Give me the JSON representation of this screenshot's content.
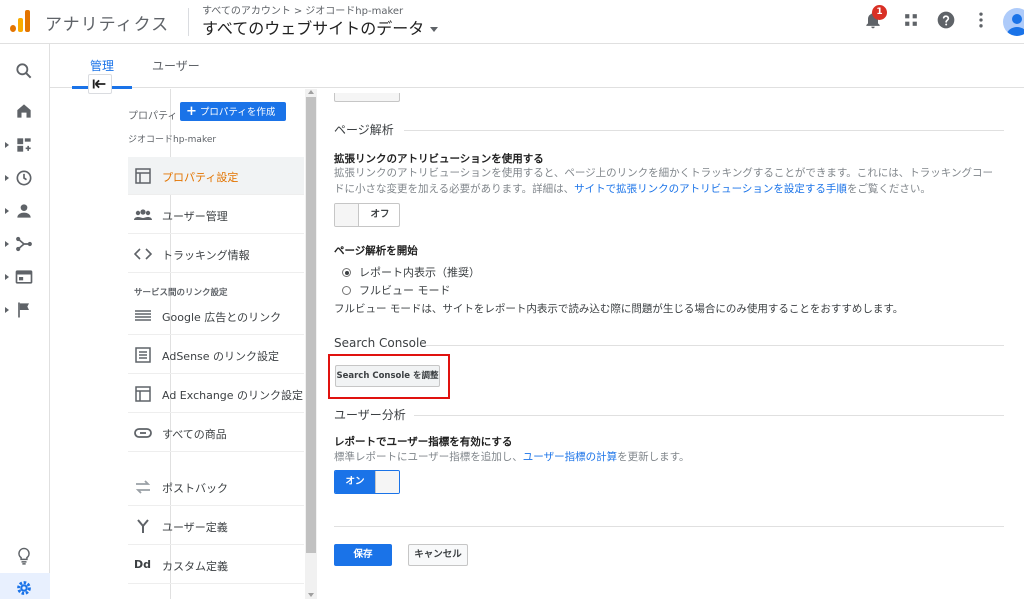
{
  "header": {
    "app_name": "アナリティクス",
    "breadcrumb": [
      "すべてのアカウント",
      "ジオコードhp-maker"
    ],
    "breadcrumb_sep": ">",
    "view_name": "すべてのウェブサイトのデータ",
    "notification_count": "1"
  },
  "tabs": [
    {
      "label": "管理"
    },
    {
      "label": "ユーザー"
    }
  ],
  "property_panel": {
    "label": "プロパティ",
    "create_button": "プロパティを作成",
    "create_plus": "+",
    "property_name": "ジオコードhp-maker",
    "items": [
      {
        "label": "プロパティ設定"
      },
      {
        "label": "ユーザー管理"
      },
      {
        "label": "トラッキング情報"
      },
      {
        "label": "Google 広告とのリンク"
      },
      {
        "label": "AdSense のリンク設定"
      },
      {
        "label": "Ad Exchange のリンク設定"
      },
      {
        "label": "すべての商品"
      },
      {
        "label": "ポストバック"
      },
      {
        "label": "ユーザー定義"
      },
      {
        "label": "カスタム定義"
      }
    ],
    "section_header": "サービス間のリンク設定",
    "custom_def_icon_text": "Dd"
  },
  "settings": {
    "page_analysis": {
      "title": "ページ解析",
      "enhanced_link": {
        "title": "拡張リンクのアトリビューションを使用する",
        "desc_prefix": "拡張リンクのアトリビューションを使用すると、ページ上のリンクを細かくトラッキングすることができます。これには、トラッキングコードに小さな変更を加える必要があります。詳細は、",
        "desc_link": "サイトで拡張リンクのアトリビューションを設定する手順",
        "desc_suffix": "をご覧ください。",
        "toggle": "オフ"
      },
      "start": {
        "title": "ページ解析を開始",
        "option_inline": "レポート内表示（推奨）",
        "option_full": "フルビュー モード",
        "note": "フルビュー モードは、サイトをレポート内表示で読み込む際に問題が生じる場合にのみ使用することをおすすめします。"
      }
    },
    "search_console": {
      "title": "Search Console",
      "button": "Search Console を調整"
    },
    "user_analysis": {
      "title": "ユーザー分析",
      "enable": {
        "title": "レポートでユーザー指標を有効にする",
        "desc_prefix": "標準レポートにユーザー指標を追加し、",
        "desc_link": "ユーザー指標の計算",
        "desc_suffix": "を更新します。",
        "toggle": "オン"
      }
    },
    "save": "保存",
    "cancel": "キャンセル"
  },
  "colors": {
    "accent": "#1a73e8",
    "active_item": "#e37400",
    "highlight": "#e0120f"
  }
}
